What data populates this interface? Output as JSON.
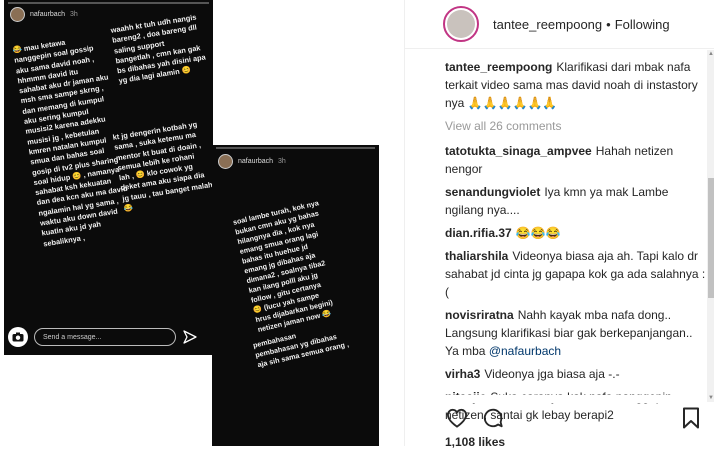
{
  "story1": {
    "username": "nafaurbach",
    "time": "3h",
    "block_left": "😂 mau ketawa\nnanggepin soal gossip\naku sama david noah ,\nhhmmm david itu\nsahabat aku dr jaman aku\nmsh sma sampe skrng ,\ndan memang di kumpul\naku sering kumpul\nmusisi2 karena adekku\nmusisi jg , kebetulan\nkmren natalan kumpul\nsmua dan bahas soal\ngosip di tv2 plus sharing\nsoal hidup 😊 , namanya\nsahabat ksh kekuatan\ndan dea kcn aku ma david\nngalamin hal yg sama ,\nwaktu aku down david\nkuatin aku jd yah\nsebaliknya ,",
    "block_right_top": "waahh kt tuh udh nangis\nbareng2 , doa bareng dll\nsaling support\nbangetlah , cmn kan gak\nbs dibahas yah disini apa\nyg dia lagi alamin 😊",
    "block_right_bottom": "kt jg dengerin kotbah yg\nsama , suka ketemu ma\nmentor kt buat di doain ,\nsemua lebih ke rohani\nlah , 😊 klo cowok yg\ndeket ama aku siapa dia\njg tauu , tau banget malah\n😂",
    "message_placeholder": "Send a message..."
  },
  "story2": {
    "username": "nafaurbach",
    "time": "3h",
    "block_main": "soal lambe turah, kok nya\nbukan cmn aku yg bahas\nhilangnya dia , kok nya\nemang smua orang lagi\nbahas itu huehue jd\nemang jg dibahas aja\ndimana2 , soalnya tiba2\nkan ilang polll aku jg\nfollow , gitu certanya\n😊 (lucu yah sampe\nhrus dijabarkan begini)\nnetizen jaman now 😂",
    "block_bottom": "pembahasan\npembahasan yg dibahas\naja sih sama semua orang ,"
  },
  "post": {
    "username": "tantee_reempoong",
    "separator": "•",
    "follow_status": "Following",
    "caption_user": "tantee_reempoong",
    "caption_text": "Klarifikasi dari mbak nafa terkait video sama mas david noah di instastory nya 🙏🙏🙏🙏🙏🙏",
    "view_all": "View all 26 comments",
    "comments": [
      {
        "user": "tatotukta_sinaga_ampvee",
        "text": "Hahah netizen nengor"
      },
      {
        "user": "senandungviolet",
        "text": "Iya kmn ya mak Lambe ngilang nya...."
      },
      {
        "user": "dian.rifia.37",
        "text": "😂😂😂"
      },
      {
        "user": "thaliarshila",
        "text": "Videonya biasa aja ah. Tapi kalo dr sahabat jd cinta jg gapapa kok ga ada salahnya :("
      },
      {
        "user": "novisriratna",
        "text": "Nahh kayak mba nafa dong.. Langsung klarifikasi biar gak berkepanjangan.. Ya mba ",
        "mention": "@nafaurbach"
      },
      {
        "user": "virha3",
        "text": "Videonya jga biasa aja -.-"
      },
      {
        "user": "nitaajie",
        "text": "Suka caranya kak nafa nanggepin netizen, santai gk lebay berapi2"
      }
    ],
    "likes": "1,108 likes"
  },
  "icons": [
    "camera-icon",
    "send-icon",
    "heart-icon",
    "comment-icon",
    "bookmark-icon"
  ]
}
